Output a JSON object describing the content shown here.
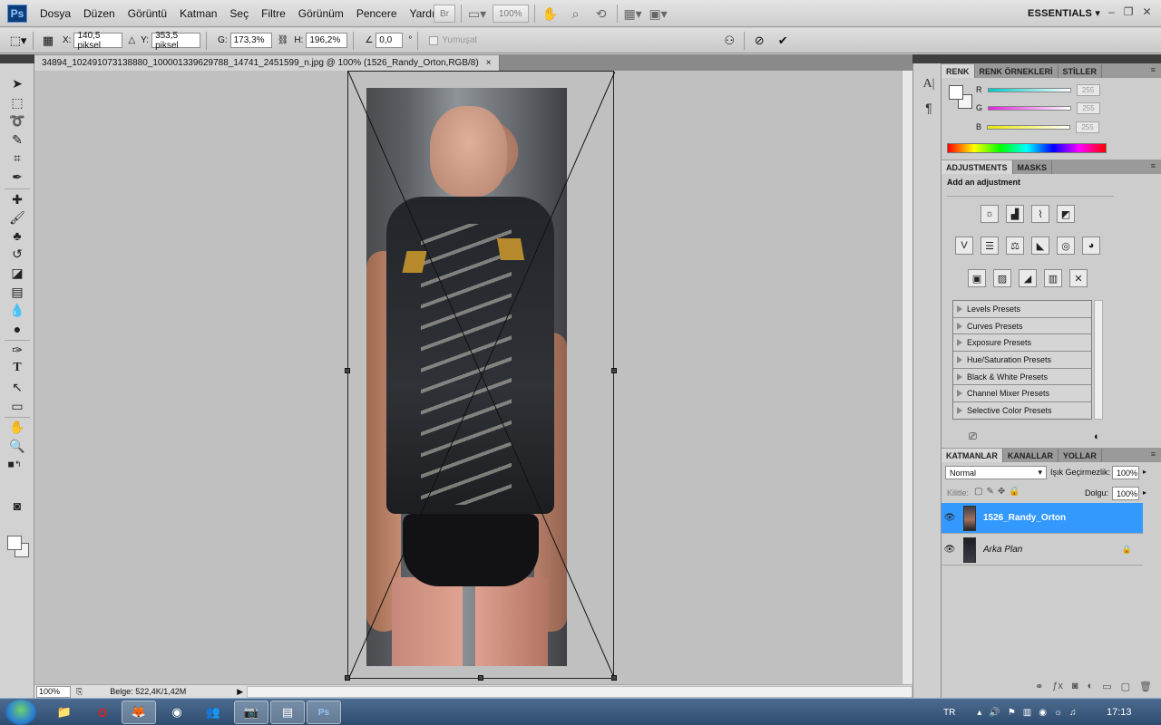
{
  "app": {
    "logo": "Ps",
    "workspace": "ESSENTIALS"
  },
  "menu": [
    "Dosya",
    "Düzen",
    "Görüntü",
    "Katman",
    "Seç",
    "Filtre",
    "Görünüm",
    "Pencere",
    "Yardım"
  ],
  "menu_tools": {
    "zoom": "100%"
  },
  "window_controls": {
    "minimize": "–",
    "restore": "❐",
    "close": "✕"
  },
  "options": {
    "x_label": "X:",
    "x_value": "140,5 piksel",
    "y_label": "Y:",
    "y_value": "353,5 piksel",
    "w_label": "G:",
    "w_value": "173,3%",
    "h_label": "H:",
    "h_value": "196,2%",
    "angle_value": "0,0",
    "angle_unit": "°",
    "antialias_label": "Yumuşat"
  },
  "document": {
    "tab_title": "34894_102491073138880_100001339629788_14741_2451599_n.jpg @ 100% (1526_Randy_Orton,RGB/8)",
    "close": "×",
    "zoom": "100%",
    "info": "Belge: 522,4K/1,42M"
  },
  "color_panel": {
    "tabs": [
      "RENK",
      "RENK ÖRNEKLERİ",
      "STİLLER"
    ],
    "channels": [
      {
        "label": "R",
        "value": "255",
        "color": "#00c8c8"
      },
      {
        "label": "G",
        "value": "255",
        "color": "#e020e0"
      },
      {
        "label": "B",
        "value": "255",
        "color": "#e8e800"
      }
    ]
  },
  "adjustments_panel": {
    "tabs": [
      "ADJUSTMENTS",
      "MASKS"
    ],
    "heading": "Add an adjustment",
    "presets": [
      "Levels Presets",
      "Curves Presets",
      "Exposure Presets",
      "Hue/Saturation Presets",
      "Black & White Presets",
      "Channel Mixer Presets",
      "Selective Color Presets"
    ]
  },
  "layers_panel": {
    "tabs": [
      "KATMANLAR",
      "KANALLAR",
      "YOLLAR"
    ],
    "blend_mode": "Normal",
    "opacity_label": "Işık Geçirmezlik:",
    "opacity_value": "100%",
    "lock_label": "Kilitle:",
    "fill_label": "Dolgu:",
    "fill_value": "100%",
    "layers": [
      {
        "name": "1526_Randy_Orton",
        "selected": true
      },
      {
        "name": "Arka Plan",
        "selected": false
      }
    ]
  },
  "taskbar": {
    "language": "TR",
    "clock": "17:13"
  },
  "colors": {
    "selection": "#3399ff",
    "taskbar": "#3b5a7e"
  }
}
